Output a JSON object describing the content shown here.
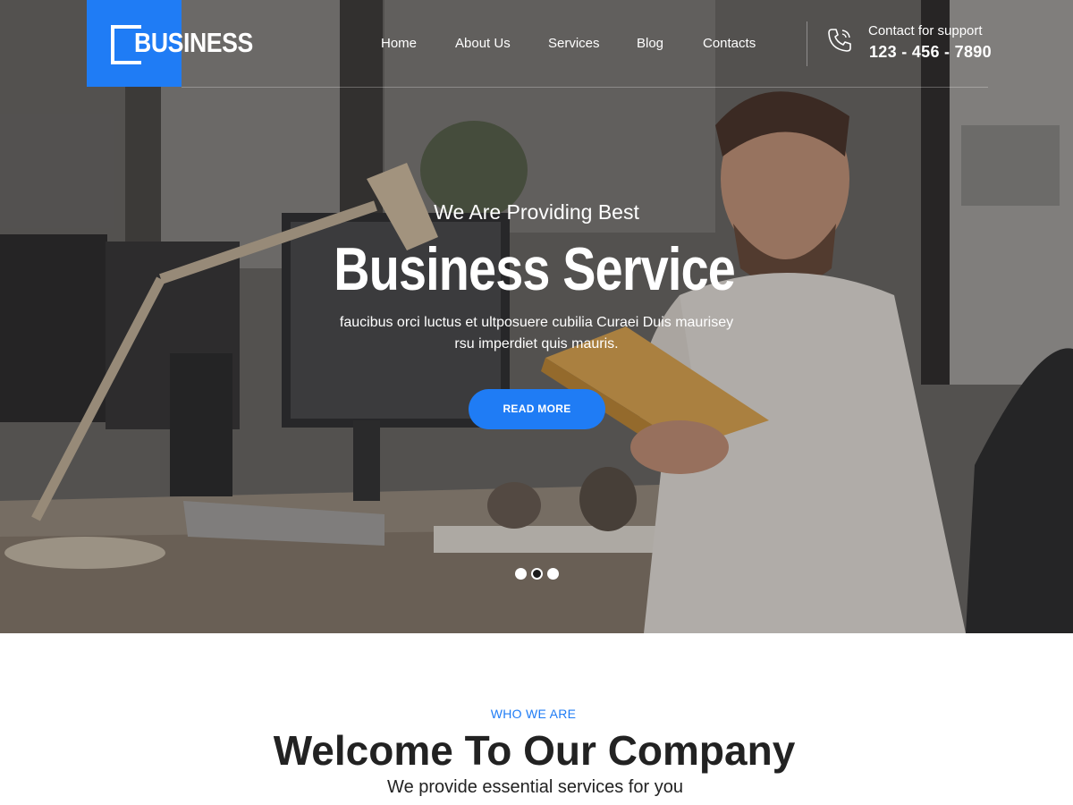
{
  "brand": {
    "name": "BUSINESS",
    "accent_color": "#1f7cf5"
  },
  "nav": {
    "items": [
      {
        "label": "Home"
      },
      {
        "label": "About Us"
      },
      {
        "label": "Services"
      },
      {
        "label": "Blog"
      },
      {
        "label": "Contacts"
      }
    ]
  },
  "support": {
    "icon": "phone-icon",
    "label": "Contact for support",
    "phone": "123 - 456 - 7890"
  },
  "hero": {
    "subtitle": "We Are Providing Best",
    "title": "Business Service",
    "description": "faucibus orci luctus et ultposuere cubilia Curaei Duis maurisey rsu imperdiet quis mauris.",
    "button_label": "READ MORE",
    "slides": {
      "count": 3,
      "active_index": 1
    }
  },
  "about": {
    "eyebrow": "WHO WE ARE",
    "title": "Welcome To Our Company",
    "subtitle": "We provide essential services for you"
  }
}
